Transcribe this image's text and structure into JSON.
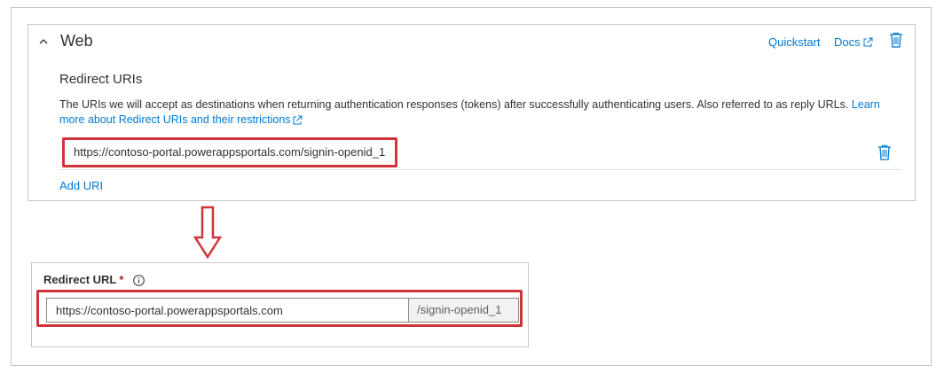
{
  "web": {
    "title": "Web",
    "quickstart_label": "Quickstart",
    "docs_label": "Docs",
    "redirect_uris_title": "Redirect URIs",
    "description": "The URIs we will accept as destinations when returning authentication responses (tokens) after successfully authenticating users. Also referred to as reply URLs. ",
    "learn_more_link": "Learn more about Redirect URIs and their restrictions",
    "uris": [
      "https://contoso-portal.powerappsportals.com/signin-openid_1"
    ],
    "add_uri_label": "Add URI"
  },
  "redirect_url": {
    "label": "Redirect URL",
    "required_marker": "*",
    "value": "https://contoso-portal.powerappsportals.com",
    "suffix": "/signin-openid_1"
  },
  "icons": {
    "collapse": "chevron-up-icon",
    "external_link": "external-link-icon",
    "delete": "trash-icon",
    "info": "info-icon",
    "arrow": "down-arrow-icon"
  },
  "colors": {
    "link": "#0078d4",
    "highlight": "#d13438",
    "required": "#a4262c",
    "border": "#c8c6c4"
  }
}
